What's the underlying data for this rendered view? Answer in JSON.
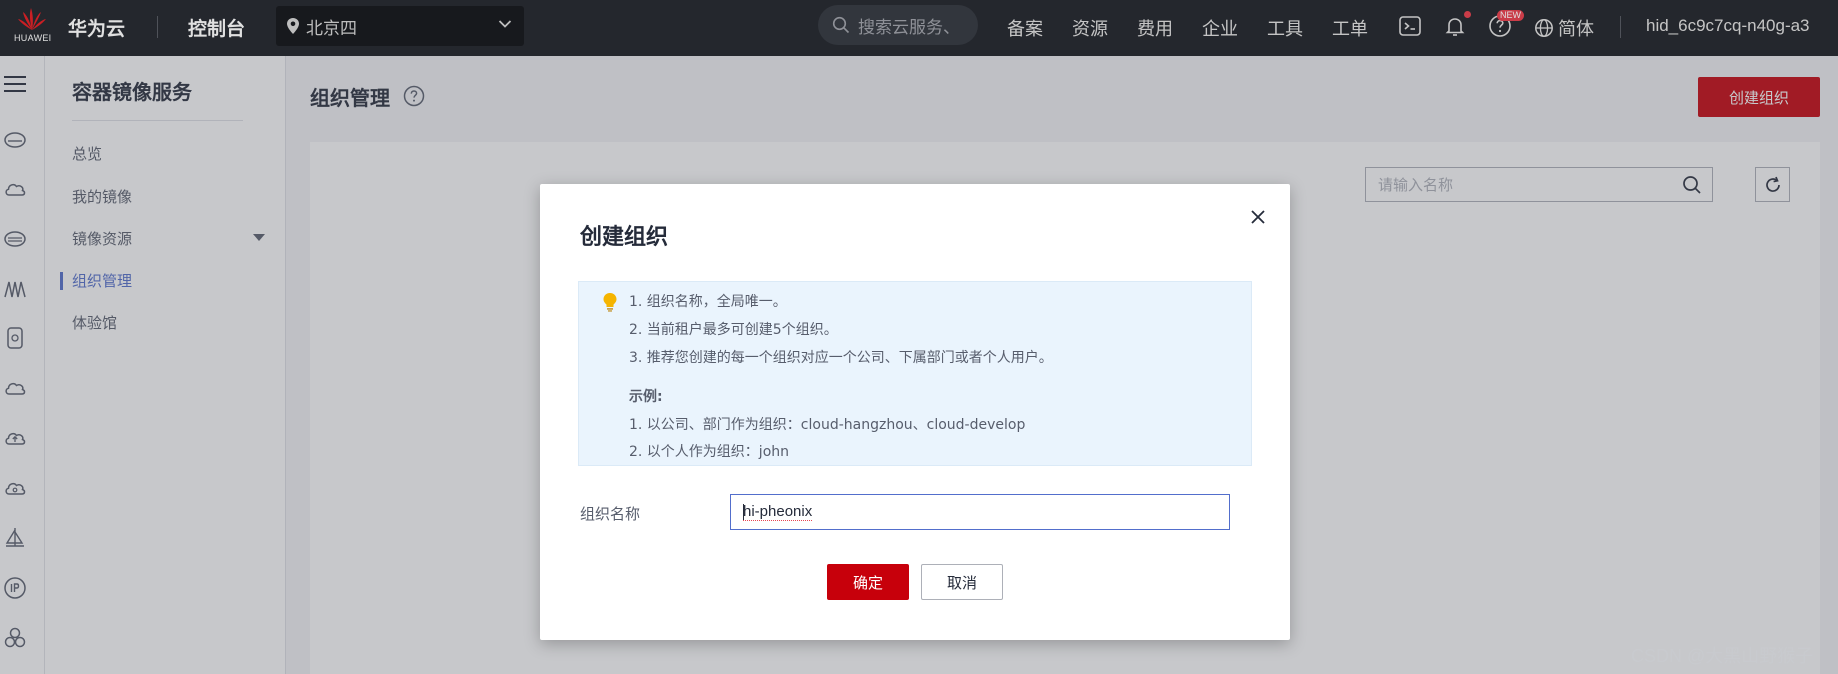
{
  "topbar": {
    "logo_text": "HUAWEI",
    "brand": "华为云",
    "console": "控制台",
    "region": "北京四",
    "search_placeholder": "搜索云服务、",
    "nav": [
      "备案",
      "资源",
      "费用",
      "企业",
      "工具",
      "工单"
    ],
    "new_badge": "NEW",
    "language": "简体",
    "username": "hid_6c9c7cq-n40g-a3"
  },
  "sidebar": {
    "service_title": "容器镜像服务",
    "items": [
      {
        "label": "总览"
      },
      {
        "label": "我的镜像"
      },
      {
        "label": "镜像资源"
      },
      {
        "label": "组织管理"
      },
      {
        "label": "体验馆"
      }
    ],
    "active_index": 3
  },
  "main": {
    "page_title": "组织管理",
    "create_button": "创建组织",
    "filter_placeholder": "请输入名称"
  },
  "modal": {
    "title": "创建组织",
    "tips": [
      "1. 组织名称，全局唯一。",
      "2. 当前租户最多可创建5个组织。",
      "3. 推荐您创建的每一个组织对应一个公司、下属部门或者个人用户。"
    ],
    "example_title": "示例:",
    "examples": [
      "1. 以公司、部门作为组织：cloud-hangzhou、cloud-develop",
      "2. 以个人作为组织：john"
    ],
    "field_label": "组织名称",
    "field_value": "hi-pheonix",
    "ok_button": "确定",
    "cancel_button": "取消"
  },
  "watermark": "CSDN @大黑山野猴子",
  "colors": {
    "brand_red": "#c7000b",
    "accent_blue": "#526ecc",
    "topbar_bg": "#2a2d34",
    "tip_bg": "#eaf4fd"
  }
}
